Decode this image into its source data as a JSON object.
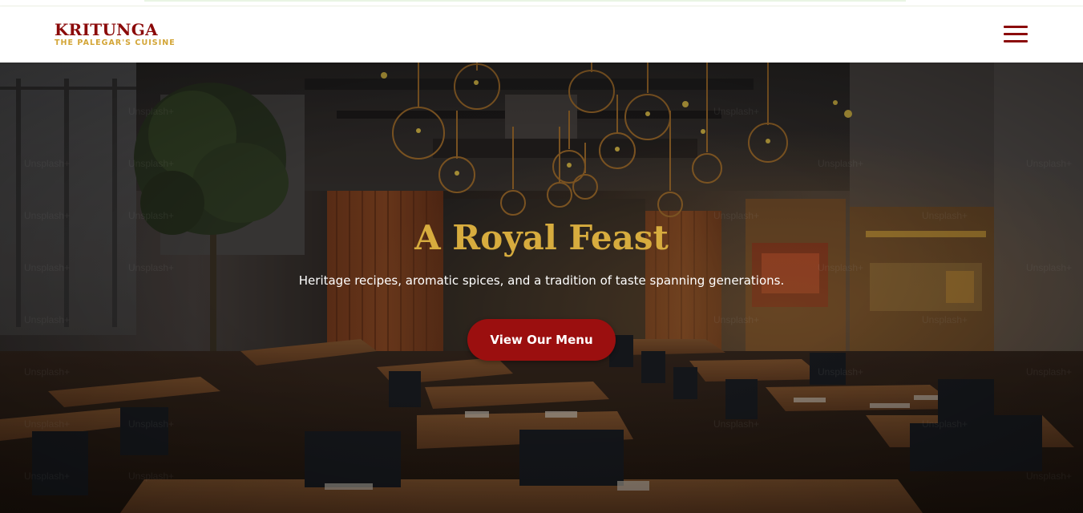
{
  "brand": {
    "name": "KRITUNGA",
    "tagline": "THE PALEGAR'S CUISINE"
  },
  "nav": {
    "menu_icon": "hamburger-menu-icon"
  },
  "hero": {
    "title": "A Royal Feast",
    "subtitle": "Heritage recipes, aromatic spices, and a tradition of taste spanning generations.",
    "cta_label": "View Our Menu",
    "watermark_text": "Unsplash+"
  },
  "colors": {
    "brand_red": "#8b0a0a",
    "gold": "#d7ac3e",
    "tagline_gold": "#d3a536",
    "button_red": "#9b0f0f"
  }
}
